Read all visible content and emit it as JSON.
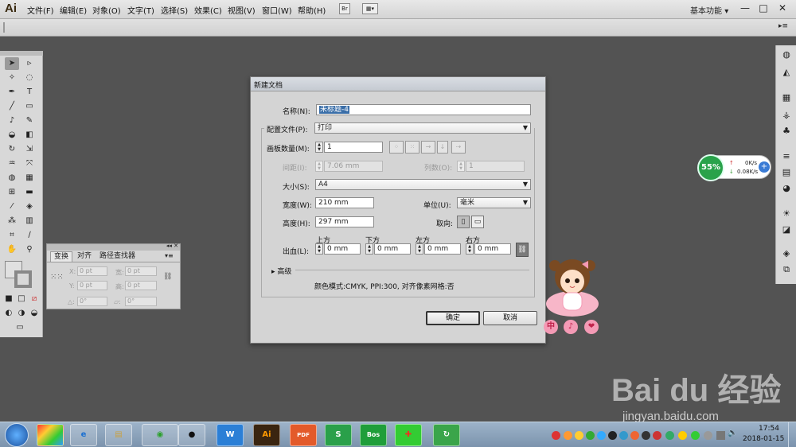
{
  "app": {
    "logo": "Ai"
  },
  "menu": {
    "items": [
      "文件(F)",
      "编辑(E)",
      "对象(O)",
      "文字(T)",
      "选择(S)",
      "效果(C)",
      "视图(V)",
      "窗口(W)",
      "帮助(H)"
    ],
    "bridge_icon": "Br",
    "workspace": "基本功能",
    "workspace_arrow": "▾",
    "min_glyph": "—",
    "max_glyph": "□",
    "close_glyph": "✕"
  },
  "transform_panel": {
    "tabs": [
      "变换",
      "对齐",
      "路径查找器"
    ],
    "x_label": "X:",
    "x_value": "0 pt",
    "y_label": "Y:",
    "y_value": "0 pt",
    "w_label": "宽:",
    "w_value": "0 pt",
    "h_label": "高:",
    "h_value": "0 pt",
    "angle_label": "△:",
    "angle_value": "0°",
    "shear_label": "▱:",
    "shear_value": "0°"
  },
  "dialog": {
    "title": "新建文档",
    "name_label": "名称(N):",
    "name_value": "未标题-4",
    "profile_label": "配置文件(P):",
    "profile_value": "打印",
    "artboards_label": "画板数量(M):",
    "artboards_value": "1",
    "spacing_label": "间距(I):",
    "spacing_value": "7.06 mm",
    "columns_label": "列数(O):",
    "columns_value": "1",
    "size_label": "大小(S):",
    "size_value": "A4",
    "width_label": "宽度(W):",
    "width_value": "210 mm",
    "units_label": "单位(U):",
    "units_value": "毫米",
    "height_label": "高度(H):",
    "height_value": "297 mm",
    "orientation_label": "取向:",
    "bleed_label": "出血(L):",
    "bleed_top_label": "上方",
    "bleed_top_value": "0 mm",
    "bleed_bottom_label": "下方",
    "bleed_bottom_value": "0 mm",
    "bleed_left_label": "左方",
    "bleed_left_value": "0 mm",
    "bleed_right_label": "右方",
    "bleed_right_value": "0 mm",
    "advanced_label": "高级",
    "summary": "颜色模式:CMYK, PPI:300, 对齐像素网格:否",
    "ok_label": "确定",
    "cancel_label": "取消"
  },
  "net_widget": {
    "percent": "55%",
    "up": "0K/s",
    "down": "0.08K/s",
    "plus": "+"
  },
  "sticker": {
    "chars": [
      "中",
      "♪",
      "❤"
    ]
  },
  "watermark": {
    "logo": "Bai du 经验",
    "url": "jingyan.baidu.com"
  },
  "taskbar": {
    "apps": [
      "W",
      "Ai",
      "PDF",
      "S",
      "Bos"
    ],
    "time": "17:54",
    "date": "2018-01-15"
  },
  "colors": {
    "canvas": "#535353",
    "selection": "#3a6ea8",
    "ai_icon": "#ff9a00",
    "net_green": "#29a24a"
  }
}
